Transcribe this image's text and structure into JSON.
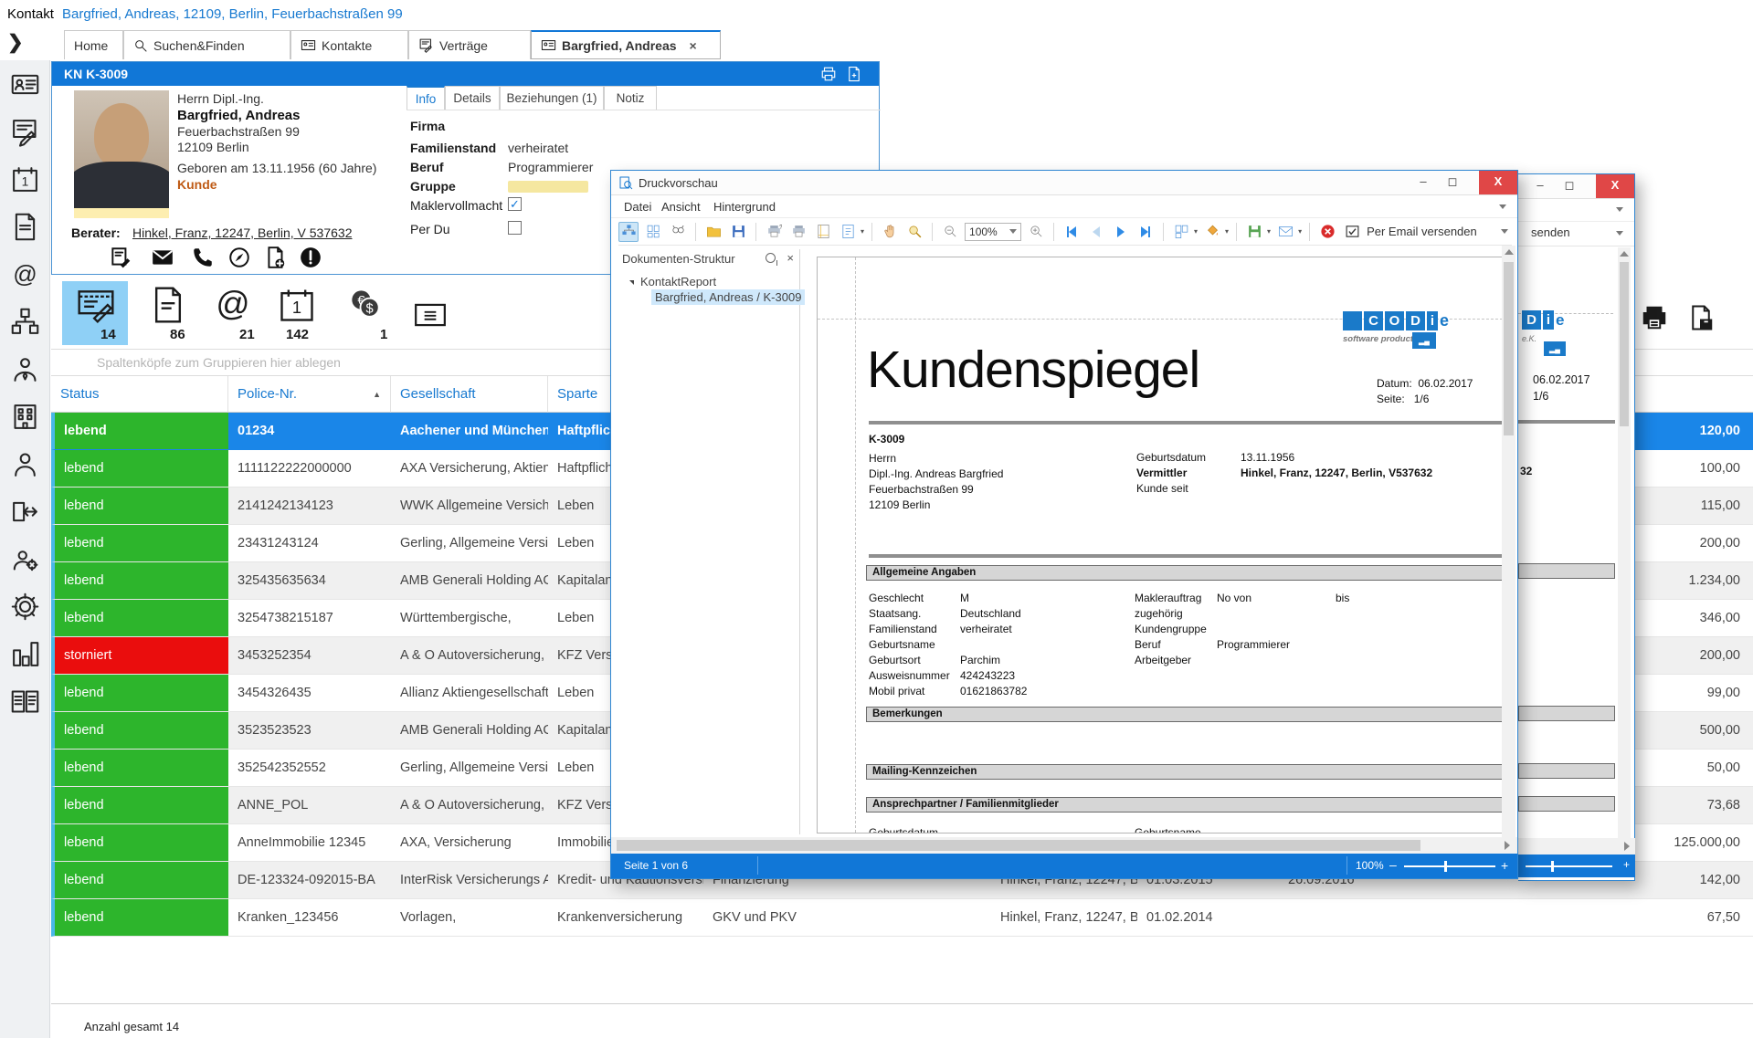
{
  "topbar": {
    "prefix": "Kontakt",
    "title": "Bargfried, Andreas, 12109, Berlin, Feuerbachstraßen 99"
  },
  "nav_tabs": {
    "items": [
      {
        "label": "Home"
      },
      {
        "label": "Suchen&Finden"
      },
      {
        "label": "Kontakte"
      },
      {
        "label": "Verträge"
      },
      {
        "label": "Bargfried, Andreas",
        "active": true
      }
    ]
  },
  "contact": {
    "header": "KN K-3009",
    "salutation": "Herrn Dipl.-Ing.",
    "name": "Bargfried, Andreas",
    "street": "Feuerbachstraßen 99",
    "city": "12109 Berlin",
    "born": "Geboren am 13.11.1956 (60 Jahre)",
    "role": "Kunde",
    "role_color": "#bf5b16",
    "berater_label": "Berater:",
    "berater": "Hinkel, Franz, 12247, Berlin, V 537632",
    "tabs": [
      {
        "label": "Info",
        "active": true
      },
      {
        "label": "Details"
      },
      {
        "label": "Beziehungen (1)"
      },
      {
        "label": "Notiz"
      }
    ],
    "fields": {
      "firma_label": "Firma",
      "familienstand_label": "Familienstand",
      "familienstand": "verheiratet",
      "beruf_label": "Beruf",
      "beruf": "Programmierer",
      "gruppe_label": "Gruppe",
      "maklervollmacht_label": "Maklervollmacht",
      "maklervollmacht_checked": true,
      "perdu_label": "Per Du",
      "perdu_checked": false
    }
  },
  "count_icons": [
    {
      "name": "vertraege",
      "count": "14",
      "active": true
    },
    {
      "name": "dokumente",
      "count": "86"
    },
    {
      "name": "emails",
      "count": "21"
    },
    {
      "name": "termine",
      "count": "142"
    },
    {
      "name": "provisionen",
      "count": "1"
    },
    {
      "name": "karte",
      "count": ""
    }
  ],
  "grid": {
    "groupby_hint": "Spaltenköpfe zum Gruppieren hier ablegen",
    "columns": [
      "Status",
      "Police-Nr.",
      "Gesellschaft",
      "Sparte"
    ],
    "rows": [
      {
        "status": "lebend",
        "police": "01234",
        "gesellschaft": "Aachener und Münchener,",
        "sparte": "Haftpflicht",
        "betrag": "120,00",
        "selected": true
      },
      {
        "status": "lebend",
        "police": "1111122222000000",
        "gesellschaft": "AXA Versicherung, Aktienge...",
        "sparte": "Haftpflicht",
        "betrag": "100,00"
      },
      {
        "status": "lebend",
        "police": "2141242134123",
        "gesellschaft": "WWK Allgemeine Versicher...",
        "sparte": "Leben",
        "betrag": "115,00"
      },
      {
        "status": "lebend",
        "police": "23431243124",
        "gesellschaft": "Gerling, Allgemeine Versich...",
        "sparte": "Leben",
        "betrag": "200,00"
      },
      {
        "status": "lebend",
        "police": "325435635634",
        "gesellschaft": "AMB Generali Holding AG,",
        "sparte": "Kapitalanla...",
        "betrag": "1.234,00"
      },
      {
        "status": "lebend",
        "police": "3254738215187",
        "gesellschaft": "Württembergische,",
        "sparte": "Leben",
        "betrag": "346,00"
      },
      {
        "status": "storniert",
        "police": "3453252354",
        "gesellschaft": "A & O Autoversicherung, Ol...",
        "sparte": "KFZ Versich...",
        "betrag": "200,00",
        "cancelled": true
      },
      {
        "status": "lebend",
        "police": "3454326435",
        "gesellschaft": "Allianz Aktiengesellschaft,",
        "sparte": "Leben",
        "betrag": "99,00"
      },
      {
        "status": "lebend",
        "police": "3523523523",
        "gesellschaft": "AMB Generali Holding AG,",
        "sparte": "Kapitalanla...",
        "betrag": "500,00"
      },
      {
        "status": "lebend",
        "police": "352542352552",
        "gesellschaft": "Gerling, Allgemeine Versich...",
        "sparte": "Leben",
        "betrag": "50,00"
      },
      {
        "status": "lebend",
        "police": "ANNE_POL",
        "gesellschaft": "A & O Autoversicherung, Ol...",
        "sparte": "KFZ Versich...",
        "betrag": "73,68"
      },
      {
        "status": "lebend",
        "police": "AnneImmobilie 12345",
        "gesellschaft": "AXA, Versicherung",
        "sparte": "Immobilien",
        "betrag": "125.000,00"
      },
      {
        "status": "lebend",
        "police": "DE-123324-092015-BA",
        "gesellschaft": "InterRisk Versicherungs AG,",
        "sparte": "Kredit- und Kautionsversich...",
        "tarif": "Finanzierung",
        "vermittler": "Hinkel, Franz, 12247, Berli...",
        "beginn": "01.03.2015",
        "ende": "26.09.2016",
        "betrag": "142,00"
      },
      {
        "status": "lebend",
        "police": "Kranken_123456",
        "gesellschaft": "Vorlagen,",
        "sparte": "Krankenversicherung",
        "tarif": "GKV und PKV",
        "vermittler": "Hinkel, Franz, 12247, Berli...",
        "beginn": "01.02.2014",
        "ende": "",
        "betrag": "67,50"
      }
    ],
    "footer_total": "Anzahl gesamt 14"
  },
  "preview": {
    "title": "Druckvorschau",
    "menu": [
      "Datei",
      "Ansicht",
      "Hintergrund"
    ],
    "zoom_value": "100%",
    "email_label": "Per Email versenden",
    "doc_panel": {
      "title": "Dokumenten-Struktur",
      "root": "KontaktReport",
      "child": "Bargfried, Andreas / K-3009"
    },
    "footer": {
      "page": "Seite 1 von 6",
      "zoom": "100%"
    },
    "report": {
      "logo_letters": [
        "C",
        "O",
        "D",
        "i"
      ],
      "logo_e": "e",
      "logo_sub": "software products e.K.",
      "title": "Kundenspiegel",
      "datum_label": "Datum:",
      "datum": "06.02.2017",
      "seite_label": "Seite:",
      "seite": "1/6",
      "knr": "K-3009",
      "address": [
        "Herrn",
        "Dipl.-Ing. Andreas Bargfried",
        "Feuerbachstraßen 99",
        "12109 Berlin"
      ],
      "head_fields": [
        {
          "label": "Geburtsdatum",
          "value": "13.11.1956",
          "bold": false
        },
        {
          "label": "Vermittler",
          "value": "Hinkel, Franz, 12247, Berlin, V537632",
          "bold": true
        },
        {
          "label": "Kunde seit",
          "value": "",
          "bold": false
        }
      ],
      "sections": [
        "Allgemeine Angaben",
        "Bemerkungen",
        "Mailing-Kennzeichen",
        "Ansprechpartner / Familienmitglieder"
      ],
      "left_fields": [
        [
          "Geschlecht",
          "M"
        ],
        [
          "Staatsang.",
          "Deutschland"
        ],
        [
          "Familienstand",
          "verheiratet"
        ],
        [
          "Geburtsname",
          ""
        ],
        [
          "Geburtsort",
          "Parchim"
        ],
        [
          "Ausweisnummer",
          "424243223"
        ],
        [
          "Mobil privat",
          "01621863782"
        ]
      ],
      "right_fields": [
        [
          "Maklerauftrag",
          "No von",
          "bis"
        ],
        [
          "zugehörig",
          "",
          ""
        ],
        [
          "Kundengruppe",
          "",
          ""
        ],
        [
          "Beruf",
          "Programmierer",
          ""
        ],
        [
          "Arbeitgeber",
          "",
          ""
        ]
      ],
      "cutoff_left": "Geburtsdatum",
      "cutoff_right": "Geburtsname"
    }
  },
  "rear_window": {
    "senden": "senden",
    "datum": "06.02.2017",
    "seite": "1/6",
    "fragment": "32",
    "logo_d": "D",
    "logo_i": "i",
    "logo_e": "e",
    "logo_sub": "e.K."
  }
}
